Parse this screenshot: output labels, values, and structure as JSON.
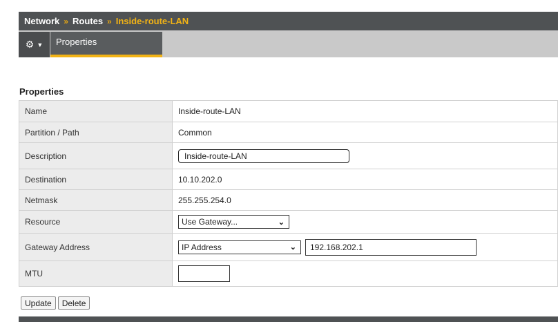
{
  "breadcrumb": {
    "items": [
      "Network",
      "Routes"
    ],
    "separator": "»",
    "current": "Inside-route-LAN"
  },
  "tabs": {
    "gear_icon": "gear-icon",
    "active": "Properties"
  },
  "section_title": "Properties",
  "properties": {
    "name": {
      "label": "Name",
      "value": "Inside-route-LAN"
    },
    "partition": {
      "label": "Partition / Path",
      "value": "Common"
    },
    "description": {
      "label": "Description",
      "value": "Inside-route-LAN"
    },
    "destination": {
      "label": "Destination",
      "value": "10.10.202.0"
    },
    "netmask": {
      "label": "Netmask",
      "value": "255.255.254.0"
    },
    "resource": {
      "label": "Resource",
      "value": "Use Gateway..."
    },
    "gateway": {
      "label": "Gateway Address",
      "type_value": "IP Address",
      "value": "192.168.202.1"
    },
    "mtu": {
      "label": "MTU",
      "value": ""
    }
  },
  "buttons": {
    "update": "Update",
    "delete": "Delete"
  },
  "colors": {
    "header_bg": "#4f5254",
    "accent": "#f2b315",
    "label_bg": "#ececec"
  }
}
